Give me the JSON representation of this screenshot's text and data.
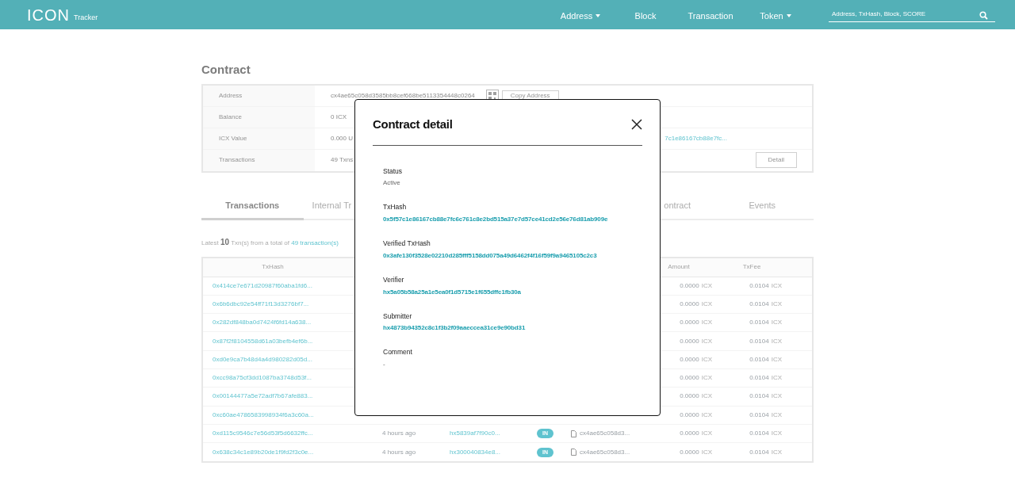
{
  "navbar": {
    "logo": "ICON",
    "logo_sub": "Tracker",
    "items": [
      {
        "label": "Address",
        "dropdown": true
      },
      {
        "label": "Block",
        "dropdown": false
      },
      {
        "label": "Transaction",
        "dropdown": false
      },
      {
        "label": "Token",
        "dropdown": true
      }
    ],
    "search": {
      "placeholder": "Address, TxHash, Block, SCORE"
    }
  },
  "page_title": "Contract",
  "info_rows": [
    {
      "label": "Address",
      "value": "cx4ae65c058d3585bb8cef668be5113354448c0264",
      "copy_button": "Copy Address"
    },
    {
      "label": "Balance",
      "value": "0 ICX"
    },
    {
      "label": "ICX Value",
      "value": "0.000 U",
      "side_link": "7c1e86167cb88e7fc..."
    },
    {
      "label": "Transactions",
      "value": "49 Txns",
      "side_button": "Detail"
    }
  ],
  "tabs": [
    {
      "label": "Transactions",
      "selected": true
    },
    {
      "label": "Internal Tr",
      "selected": false
    },
    {
      "label": "ontract",
      "selected": false
    },
    {
      "label": "Events",
      "selected": false
    }
  ],
  "summary": {
    "prefix": "Latest",
    "count": "10",
    "middle": "Txn(s) from a total of",
    "link": "49 transaction(s)"
  },
  "table": {
    "columns": {
      "txhash": "TxHash",
      "amount": "Amount",
      "fee": "TxFee"
    },
    "rows": [
      {
        "txhash": "0x414ce7e671d20987f60aba1fd6...",
        "amount": "0.0000",
        "unit": "ICX",
        "fee": "0.0104",
        "fee_unit": "ICX"
      },
      {
        "txhash": "0x6b6dbc92e54ff71f13d3276bf7...",
        "amount": "0.0000",
        "unit": "ICX",
        "fee": "0.0104",
        "fee_unit": "ICX"
      },
      {
        "txhash": "0x282df848ba0d7424f6fd14a638...",
        "amount": "0.0000",
        "unit": "ICX",
        "fee": "0.0104",
        "fee_unit": "ICX"
      },
      {
        "txhash": "0x87f2f8104558d61a03befb4ef6b...",
        "amount": "0.0000",
        "unit": "ICX",
        "fee": "0.0104",
        "fee_unit": "ICX"
      },
      {
        "txhash": "0xd0e9ca7b48d4a4d980282d05d...",
        "amount": "0.0000",
        "unit": "ICX",
        "fee": "0.0104",
        "fee_unit": "ICX"
      },
      {
        "txhash": "0xcc98a75cf3dd1087ba3748d53f...",
        "amount": "0.0000",
        "unit": "ICX",
        "fee": "0.0104",
        "fee_unit": "ICX"
      },
      {
        "txhash": "0x00144477a5e72adf7b67afe883...",
        "amount": "0.0000",
        "unit": "ICX",
        "fee": "0.0104",
        "fee_unit": "ICX"
      },
      {
        "txhash": "0xc60ae4786583998934f6a3c60a...",
        "amount": "0.0000",
        "unit": "ICX",
        "fee": "0.0104",
        "fee_unit": "ICX"
      },
      {
        "txhash": "0xd115c9546c7e56d53f5d6632ffc...",
        "age": "4 hours ago",
        "from": "hx5839af7f90c0...",
        "direction": "IN",
        "to": "cx4ae65c058d3...",
        "amount": "0.0000",
        "unit": "ICX",
        "fee": "0.0104",
        "fee_unit": "ICX"
      },
      {
        "txhash": "0x638c34c1e89b20de1f9fd2f3c0e...",
        "age": "4 hours ago",
        "from": "hx300040834e8...",
        "direction": "IN",
        "to": "cx4ae65c058d3...",
        "amount": "0.0000",
        "unit": "ICX",
        "fee": "0.0104",
        "fee_unit": "ICX"
      }
    ]
  },
  "modal": {
    "title": "Contract detail",
    "fields": [
      {
        "label": "Status",
        "value": "Active",
        "kind": "text"
      },
      {
        "label": "TxHash",
        "value": "0x5f57c1e86167cb88e7fc6c761c8e2bd515a37e7d57ce41cd2e56e76d81ab909e",
        "kind": "link"
      },
      {
        "label": "Verified TxHash",
        "value": "0x3afe130f3528e02210d285fff5158dd075a49d6462f4f16f59f9a9465105c2c3",
        "kind": "link"
      },
      {
        "label": "Verifier",
        "value": "hx5a05b58a25a1e5ea0f1d5715e1f655dffc1fb30a",
        "kind": "link"
      },
      {
        "label": "Submitter",
        "value": "hx4873b94352c8c1f3b2f09aaeccea31ce9e90bd31",
        "kind": "link"
      },
      {
        "label": "Comment",
        "value": "-",
        "kind": "text"
      }
    ]
  }
}
